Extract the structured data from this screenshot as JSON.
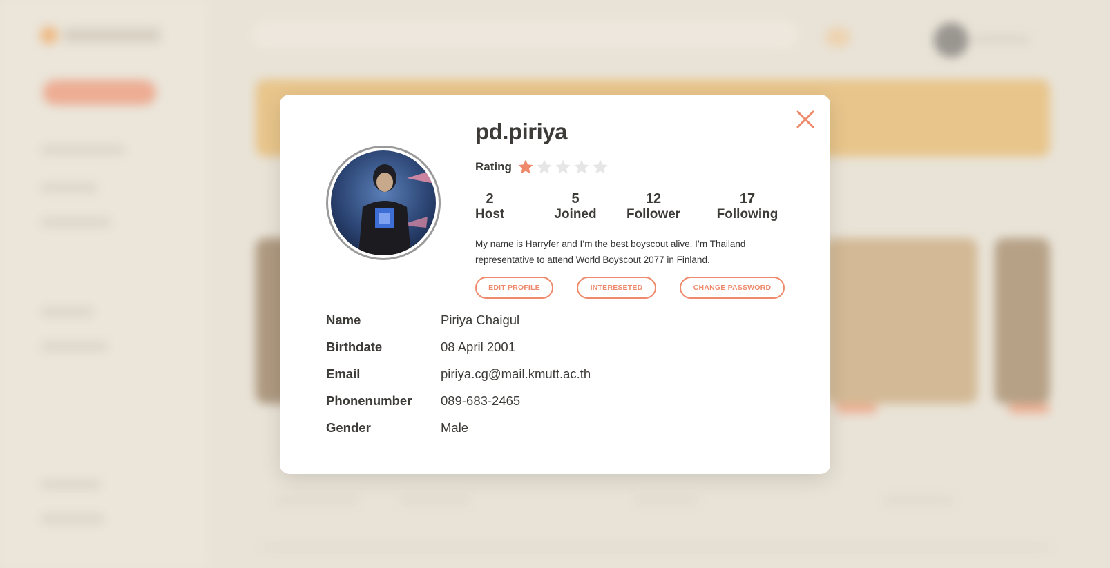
{
  "profile": {
    "username": "pd.piriya",
    "rating_label": "Rating",
    "rating": 1,
    "rating_max": 5,
    "stats": [
      {
        "value": "2",
        "label": "Host"
      },
      {
        "value": "5",
        "label": "Joined"
      },
      {
        "value": "12",
        "label": "Follower"
      },
      {
        "value": "17",
        "label": "Following"
      }
    ],
    "bio_line1": "My name is Harryfer and I’m the best boyscout alive. I’m Thailand",
    "bio_line2": "representative to attend World Boyscout 2077 in Finland.",
    "buttons": {
      "edit_profile": "EDIT PROFILE",
      "interested": "INTERESETED",
      "change_password": "CHANGE PASSWORD"
    },
    "details": [
      {
        "key": "Name",
        "value": "Piriya Chaigul"
      },
      {
        "key": "Birthdate",
        "value": "08 April 2001"
      },
      {
        "key": "Email",
        "value": "piriya.cg@mail.kmutt.ac.th"
      },
      {
        "key": "Phonenumber",
        "value": "089-683-2465"
      },
      {
        "key": "Gender",
        "value": "Male"
      }
    ]
  },
  "icons": {
    "close": "close-icon",
    "star_filled": "star-filled-icon",
    "star_empty": "star-empty-icon"
  },
  "colors": {
    "accent": "#ee8a6b",
    "star_filled": "#ee8a6b",
    "star_empty": "#e6e6e6",
    "text": "#3d3b38"
  }
}
